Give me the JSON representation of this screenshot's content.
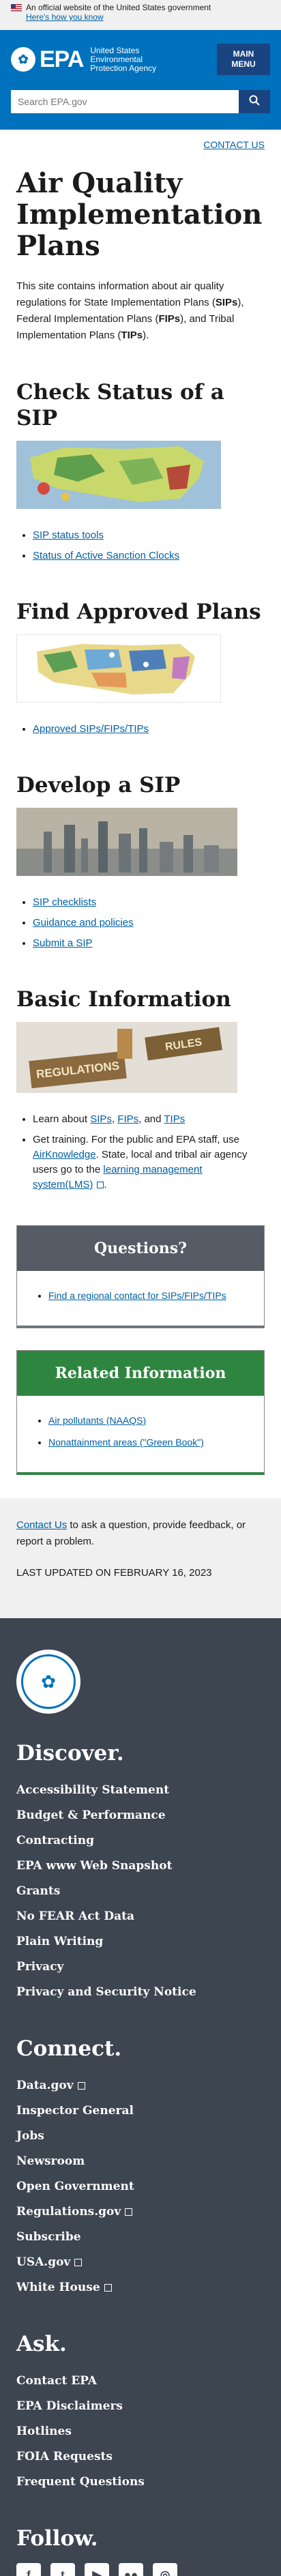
{
  "gov_banner": {
    "official_text": "An official website of the United States government",
    "how_link": "Here's how you know"
  },
  "header": {
    "logo_text": "EPA",
    "agency_name": "United States Environmental Protection Agency",
    "menu_label_1": "MAIN",
    "menu_label_2": "MENU",
    "search_placeholder": "Search EPA.gov"
  },
  "contact_us": "CONTACT US",
  "page": {
    "title": "Air Quality Implementation Plans",
    "intro_1": "This site contains information about air quality regulations for State Implementation Plans (",
    "sips": "SIPs",
    "intro_2": "), Federal Implementation Plans (",
    "fips": "FIPs",
    "intro_3": "), and Tribal Implementation Plans (",
    "tips": "TIPs",
    "intro_4": ")."
  },
  "sections": {
    "check": {
      "title": "Check Status of a SIP",
      "links": [
        "SIP status tools",
        "Status of Active Sanction Clocks"
      ]
    },
    "find": {
      "title": "Find Approved Plans",
      "links": [
        "Approved SIPs/FIPs/TIPs"
      ]
    },
    "develop": {
      "title": "Develop a SIP",
      "links": [
        "SIP checklists",
        "Guidance and policies",
        "Submit a SIP"
      ]
    },
    "basic": {
      "title": "Basic Information",
      "learn_prefix": "Learn about ",
      "learn_sips": "SIPs",
      "comma": ", ",
      "learn_fips": "FIPs",
      "and": ", and ",
      "learn_tips": "TIPs",
      "training_1": "Get training. For the public and EPA staff, use ",
      "airknowledge": "AirKnowledge",
      "training_2": ". State, local and tribal air agency users go to the ",
      "lms": "learning management system(LMS)",
      "training_3": "."
    }
  },
  "images": {
    "regulations_sign": "REGULATIONS",
    "rules_sign": "RULES"
  },
  "questions": {
    "title": "Questions?",
    "link": "Find a regional contact for SIPs/FIPs/TIPs"
  },
  "related": {
    "title": "Related Information",
    "links": [
      "Air pollutants (NAAQS)",
      "Nonattainment areas (\"Green Book\")"
    ]
  },
  "contact_area": {
    "contact_link": "Contact Us",
    "text": " to ask a question, provide feedback, or report a problem.",
    "updated": "LAST UPDATED ON FEBRUARY 16, 2023"
  },
  "footer": {
    "discover_title": "Discover.",
    "discover": [
      "Accessibility Statement",
      "Budget & Performance",
      "Contracting",
      "EPA www Web Snapshot",
      "Grants",
      "No FEAR Act Data",
      "Plain Writing",
      "Privacy",
      "Privacy and Security Notice"
    ],
    "connect_title": "Connect.",
    "connect": [
      "Data.gov",
      "Inspector General",
      "Jobs",
      "Newsroom",
      "Open Government",
      "Regulations.gov",
      "Subscribe",
      "USA.gov",
      "White House"
    ],
    "ask_title": "Ask.",
    "ask": [
      "Contact EPA",
      "EPA Disclaimers",
      "Hotlines",
      "FOIA Requests",
      "Frequent Questions"
    ],
    "follow_title": "Follow.",
    "social_icons": [
      "facebook-icon",
      "twitter-icon",
      "youtube-icon",
      "flickr-icon",
      "instagram-icon"
    ]
  }
}
